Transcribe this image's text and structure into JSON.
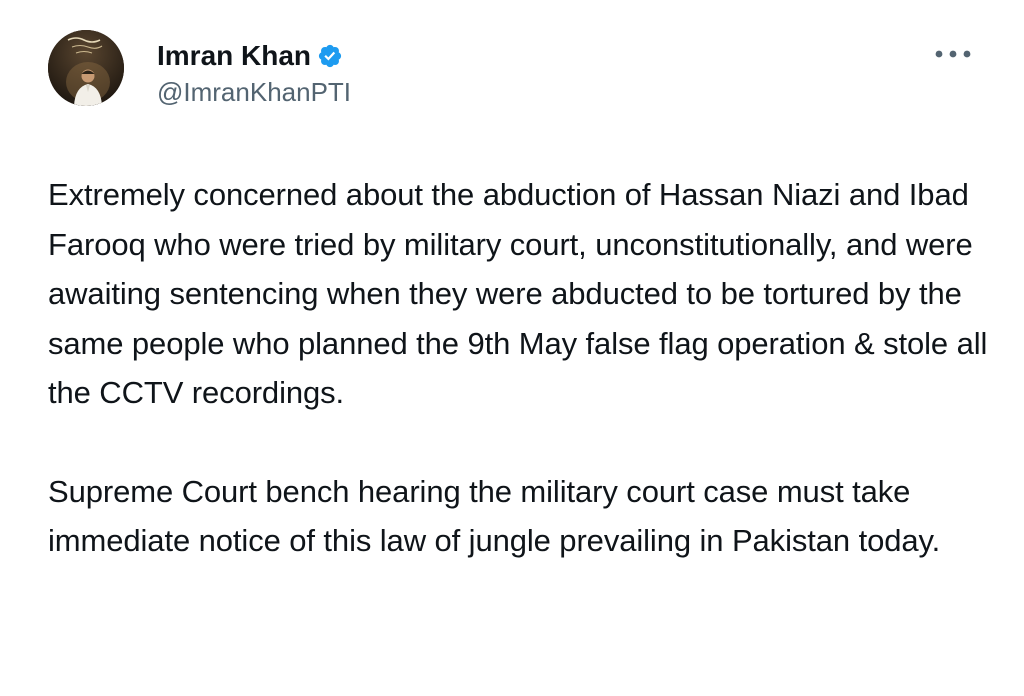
{
  "author": {
    "display_name": "Imran Khan",
    "handle": "@ImranKhanPTI",
    "verified": true,
    "avatar_icon": "profile-photo-avatar"
  },
  "menu": {
    "icon": "more-options-icon"
  },
  "tweet": {
    "paragraphs": [
      "Extremely concerned about the abduction of Hassan Niazi and Ibad Farooq who were tried by military court, unconstitutionally, and were awaiting sentencing when they were abducted to be tortured by the same people who planned the 9th May false flag operation & stole all the CCTV recordings.",
      "Supreme Court bench hearing the military court case must take immediate notice of this law of jungle prevailing in Pakistan today."
    ]
  },
  "colors": {
    "text": "#0f1419",
    "secondary": "#536471",
    "verified_blue": "#1d9bf0"
  }
}
